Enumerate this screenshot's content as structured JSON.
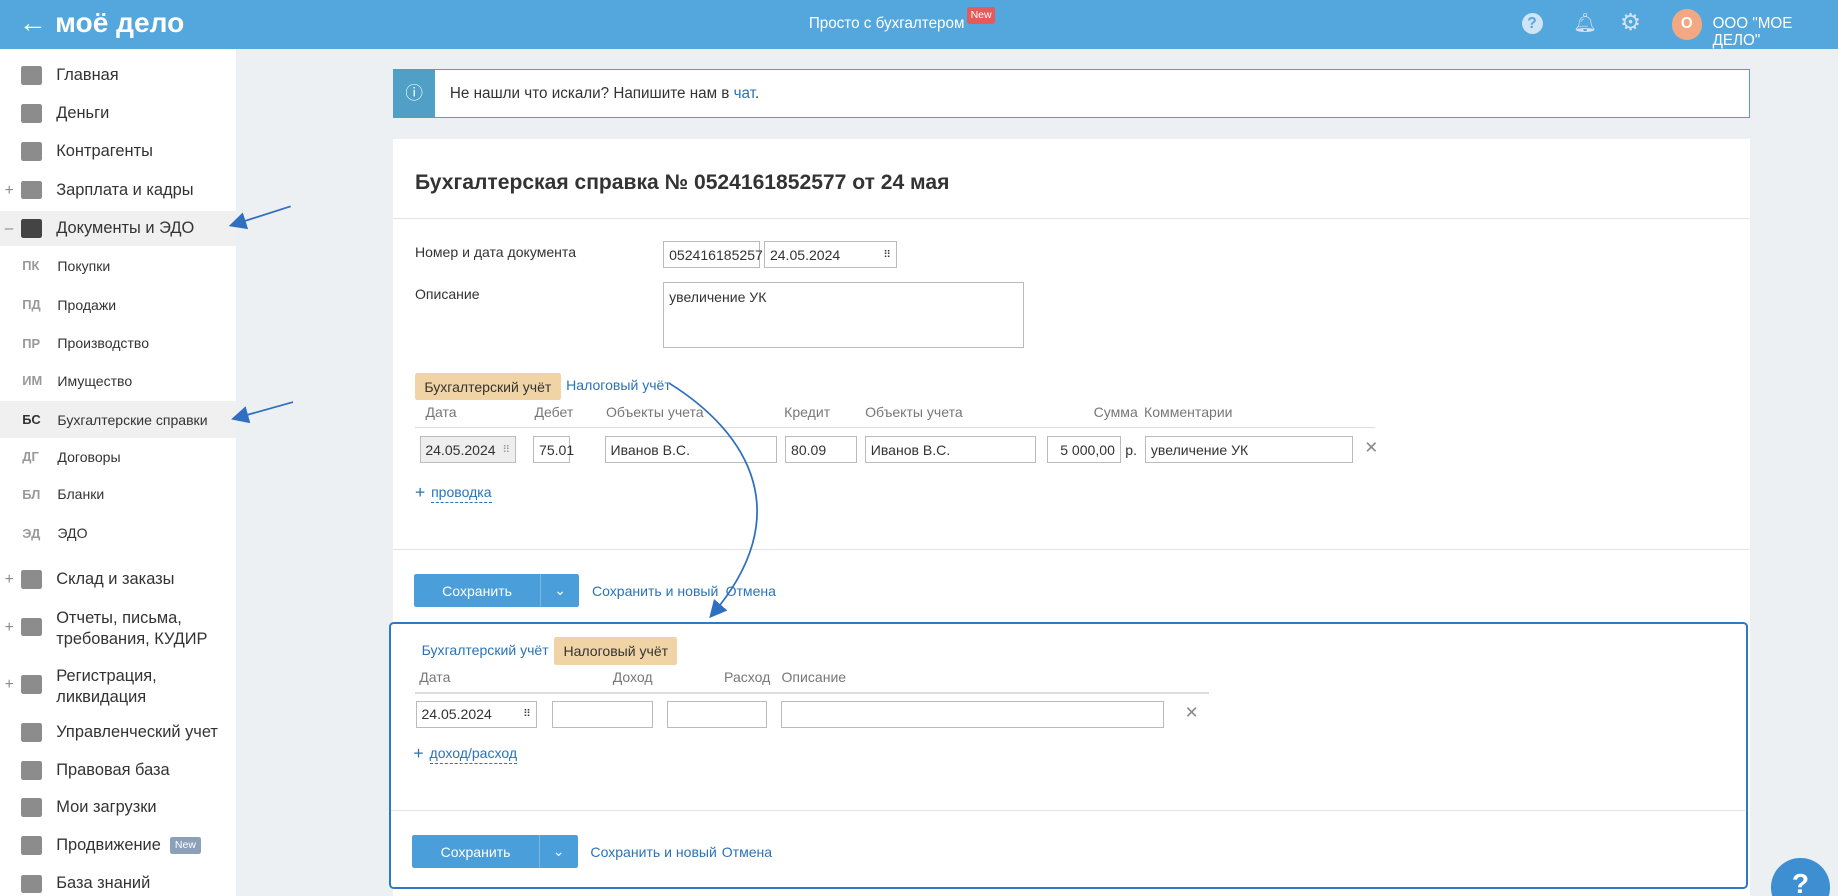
{
  "header": {
    "logo": "моё дело",
    "center": "Просто с бухгалтером",
    "badge": "New",
    "avatar_letter": "О",
    "company": "ООО \"МОЕ ДЕЛО\""
  },
  "sidebar": {
    "items": [
      {
        "label": "Главная"
      },
      {
        "label": "Деньги"
      },
      {
        "label": "Контрагенты"
      },
      {
        "label": "Зарплата и кадры",
        "plus": "+"
      },
      {
        "label": "Документы и ЭДО",
        "plus": "–"
      }
    ],
    "sub": [
      {
        "abbr": "ПК",
        "label": "Покупки"
      },
      {
        "abbr": "ПД",
        "label": "Продажи"
      },
      {
        "abbr": "ПР",
        "label": "Производство"
      },
      {
        "abbr": "ИМ",
        "label": "Имущество"
      },
      {
        "abbr": "БС",
        "label": "Бухгалтерские справки"
      },
      {
        "abbr": "ДГ",
        "label": "Договоры"
      },
      {
        "abbr": "БЛ",
        "label": "Бланки"
      },
      {
        "abbr": "ЭД",
        "label": "ЭДО"
      }
    ],
    "items2": [
      {
        "label": "Склад и заказы"
      },
      {
        "label": "Отчеты, письма,"
      },
      {
        "label": "требования, КУДИР"
      },
      {
        "label": "Регистрация,"
      },
      {
        "label": "ликвидация"
      },
      {
        "label": "Управленческий учет"
      },
      {
        "label": "Правовая база"
      },
      {
        "label": "Мои загрузки"
      },
      {
        "label": "Продвижение",
        "badge": "New"
      },
      {
        "label": "База знаний"
      }
    ]
  },
  "info": {
    "text": "Не нашли что искали? Напишите нам в ",
    "link": "чат",
    "dot": "."
  },
  "doc": {
    "title": "Бухгалтерская справка № 0524161852577 от 24 мая",
    "num_label": "Номер и дата документа",
    "number": "052416185257",
    "date": "24.05.2024",
    "desc_label": "Описание",
    "desc": "увеличение УК"
  },
  "acc": {
    "tab1": "Бухгалтерский учёт",
    "tab2": "Налоговый учёт",
    "cols": [
      "Дата",
      "Дебет",
      "Объекты учета",
      "Кредит",
      "Объекты учета",
      "Сумма",
      "Комментарии"
    ],
    "row": {
      "date": "24.05.2024",
      "debit": "75.01",
      "obj1": "Иванов В.С.",
      "credit": "80.09",
      "obj2": "Иванов В.С.",
      "sum": "5 000,00",
      "cur": "р.",
      "comment": "увеличение УК"
    },
    "add": "проводка"
  },
  "tax": {
    "cols": [
      "Дата",
      "Доход",
      "Расход",
      "Описание"
    ],
    "date": "24.05.2024",
    "add": "доход/расход"
  },
  "buttons": {
    "save": "Сохранить",
    "save_new": "Сохранить и новый",
    "cancel": "Отмена"
  },
  "help": "?"
}
